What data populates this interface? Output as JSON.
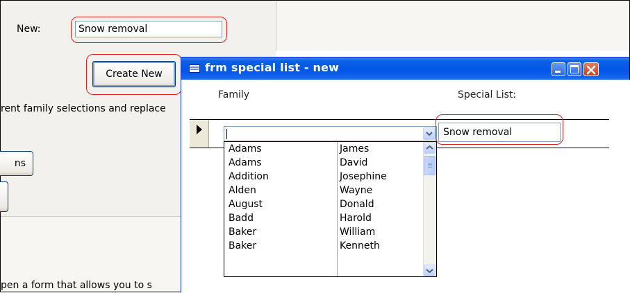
{
  "form": {
    "new_label": "New:",
    "new_value": "Snow removal",
    "create_button": "Create New",
    "help_text_top": "rent family selections and replace",
    "help_text_bottom": "pen a form that allows you to s",
    "side_button_label": "ns"
  },
  "dialog": {
    "title": "frm special list - new",
    "icon": "form-icon",
    "controls": [
      "minimize-icon",
      "maximize-icon",
      "close-icon"
    ],
    "columns": {
      "family": "Family",
      "special_list": "Special List:"
    },
    "family_value": "",
    "special_list_value": "Snow removal",
    "dropdown": {
      "rows": [
        {
          "last": "Adams",
          "first": "James"
        },
        {
          "last": "Adams",
          "first": "David"
        },
        {
          "last": "Addition",
          "first": "Josephine"
        },
        {
          "last": "Alden",
          "first": "Wayne"
        },
        {
          "last": "August",
          "first": "Donald"
        },
        {
          "last": "Badd",
          "first": "Harold"
        },
        {
          "last": "Baker",
          "first": "William"
        },
        {
          "last": "Baker",
          "first": "Kenneth"
        }
      ]
    }
  },
  "colors": {
    "highlight": "#e02020",
    "titlebar": "#0256e8",
    "close_button": "#c8411f"
  }
}
